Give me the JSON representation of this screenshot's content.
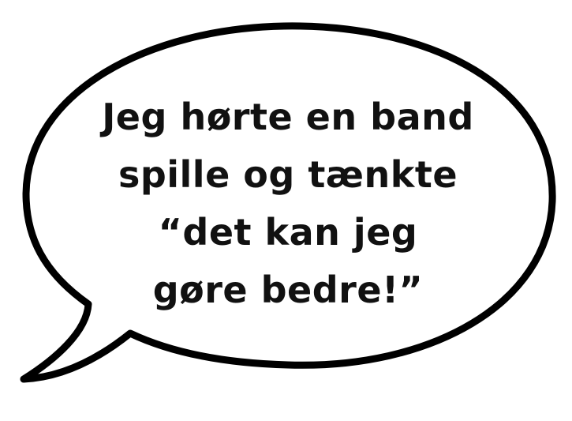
{
  "speech_bubble": {
    "lines": [
      "Jeg hørte en band",
      "spille og tænkte",
      "“det kan jeg",
      "gøre bedre!”"
    ],
    "outline_color": "#000000",
    "fill_color": "#ffffff",
    "text_color": "#111111"
  }
}
